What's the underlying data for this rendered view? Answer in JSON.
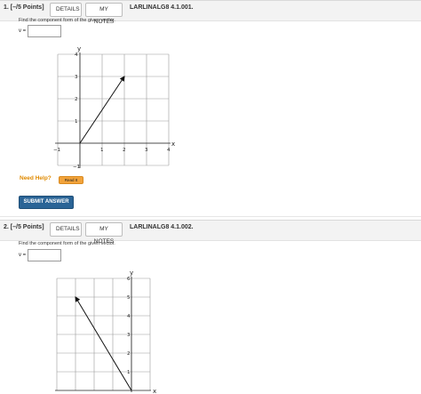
{
  "questions": [
    {
      "number": "1.",
      "points": "[–/5 Points]",
      "details_label": "DETAILS",
      "my_notes_label": "MY NOTES",
      "code": "LARLINALG8 4.1.001.",
      "prompt": "Find the component form of the given vector.",
      "answer_label": "v =",
      "answer_value": "",
      "graph": {
        "x_axis_label": "x",
        "y_axis_label": "y",
        "x_ticks": [
          "−1",
          "1",
          "2",
          "3",
          "4"
        ],
        "y_ticks": [
          "−1",
          "1",
          "2",
          "3",
          "4"
        ],
        "vector": {
          "from": [
            0,
            0
          ],
          "to": [
            2,
            3
          ]
        }
      },
      "need_help_label": "Need Help?",
      "read_it_label": "Read It",
      "submit_label": "SUBMIT ANSWER"
    },
    {
      "number": "2.",
      "points": "[–/5 Points]",
      "details_label": "DETAILS",
      "my_notes_label": "MY NOTES",
      "code": "LARLINALG8 4.1.002.",
      "prompt": "Find the component form of the given vector.",
      "answer_label": "v =",
      "answer_value": "",
      "graph": {
        "x_axis_label": "x",
        "y_axis_label": "y",
        "y_ticks": [
          "1",
          "2",
          "3",
          "4",
          "5",
          "6"
        ],
        "vector": {
          "from": [
            4,
            0
          ],
          "to": [
            1,
            5
          ]
        }
      }
    }
  ],
  "colors": {
    "header_bg": "#f3f3f3",
    "submit_bg": "#2a6496",
    "need_help": "#e08a00",
    "read_it_bg": "#f2a33b"
  }
}
